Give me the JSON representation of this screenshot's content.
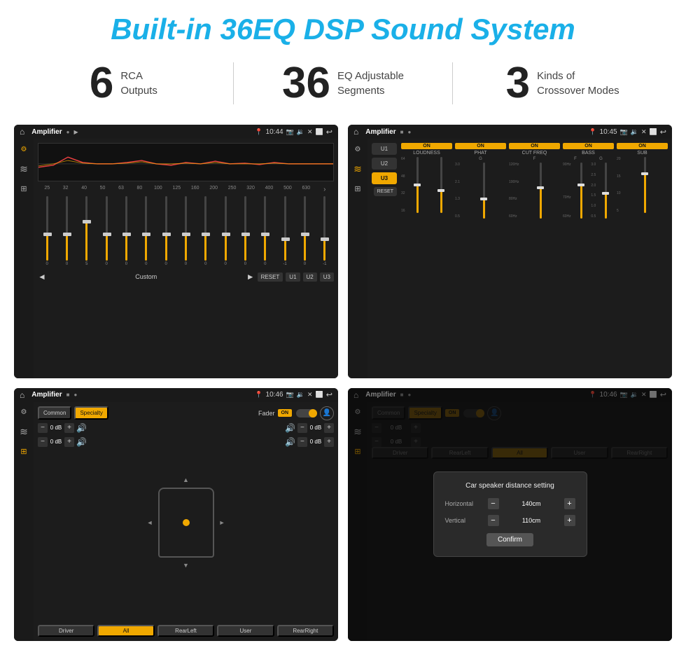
{
  "title": "Built-in 36EQ DSP Sound System",
  "features": [
    {
      "number": "6",
      "line1": "RCA",
      "line2": "Outputs"
    },
    {
      "number": "36",
      "line1": "EQ Adjustable",
      "line2": "Segments"
    },
    {
      "number": "3",
      "line1": "Kinds of",
      "line2": "Crossover Modes"
    }
  ],
  "screens": {
    "eq": {
      "title": "Amplifier",
      "time": "10:44",
      "labels": [
        "25",
        "32",
        "40",
        "50",
        "63",
        "80",
        "100",
        "125",
        "160",
        "200",
        "250",
        "320",
        "400",
        "500",
        "630"
      ],
      "values": [
        "0",
        "0",
        "5",
        "0",
        "0",
        "0",
        "0",
        "0",
        "0",
        "0",
        "0",
        "0",
        "-1",
        "0",
        "-1"
      ],
      "thumbPositions": [
        50,
        50,
        30,
        50,
        50,
        50,
        50,
        50,
        50,
        50,
        50,
        50,
        70,
        50,
        70
      ],
      "activeBtn": "Custom",
      "buttons": [
        "Custom",
        "RESET",
        "U1",
        "U2",
        "U3"
      ]
    },
    "amp": {
      "title": "Amplifier",
      "time": "10:45",
      "presets": [
        "U1",
        "U2",
        "U3"
      ],
      "activePreset": "U3",
      "channels": [
        {
          "name": "LOUDNESS",
          "toggle": "ON"
        },
        {
          "name": "PHAT",
          "toggle": "ON"
        },
        {
          "name": "CUT FREQ",
          "toggle": "ON"
        },
        {
          "name": "BASS",
          "toggle": "ON"
        },
        {
          "name": "SUB",
          "toggle": "ON"
        }
      ],
      "resetBtn": "RESET"
    },
    "fader": {
      "title": "Amplifier",
      "time": "10:46",
      "tabs": [
        "Common",
        "Specialty"
      ],
      "activeTab": "Specialty",
      "faderLabel": "Fader",
      "faderToggle": "ON",
      "volumes": [
        "0 dB",
        "0 dB",
        "0 dB",
        "0 dB"
      ],
      "bottomBtns": [
        "Driver",
        "All",
        "RearLeft",
        "User",
        "RearRight"
      ],
      "activeBottomBtn": "All"
    },
    "speaker": {
      "title": "Amplifier",
      "time": "10:46",
      "tabs": [
        "Common",
        "Specialty"
      ],
      "activeTab": "Specialty",
      "faderToggle": "ON",
      "dialog": {
        "title": "Car speaker distance setting",
        "rows": [
          {
            "label": "Horizontal",
            "value": "140cm"
          },
          {
            "label": "Vertical",
            "value": "110cm"
          }
        ],
        "confirmBtn": "Confirm"
      },
      "volumes": [
        "0 dB",
        "0 dB"
      ],
      "bottomBtns": [
        "Driver",
        "RearLeft",
        "All",
        "User",
        "RearRight"
      ]
    }
  },
  "icons": {
    "home": "⌂",
    "eq_icon": "⚙",
    "wave": "〜",
    "speaker": "🔊",
    "back": "↩",
    "location": "📍",
    "camera": "📷",
    "sound": "🔉",
    "close": "✕",
    "screen": "⬜",
    "tune": "⊞",
    "chevron_right": "›",
    "up": "▲",
    "down": "▼",
    "left": "◄",
    "right": "►"
  }
}
